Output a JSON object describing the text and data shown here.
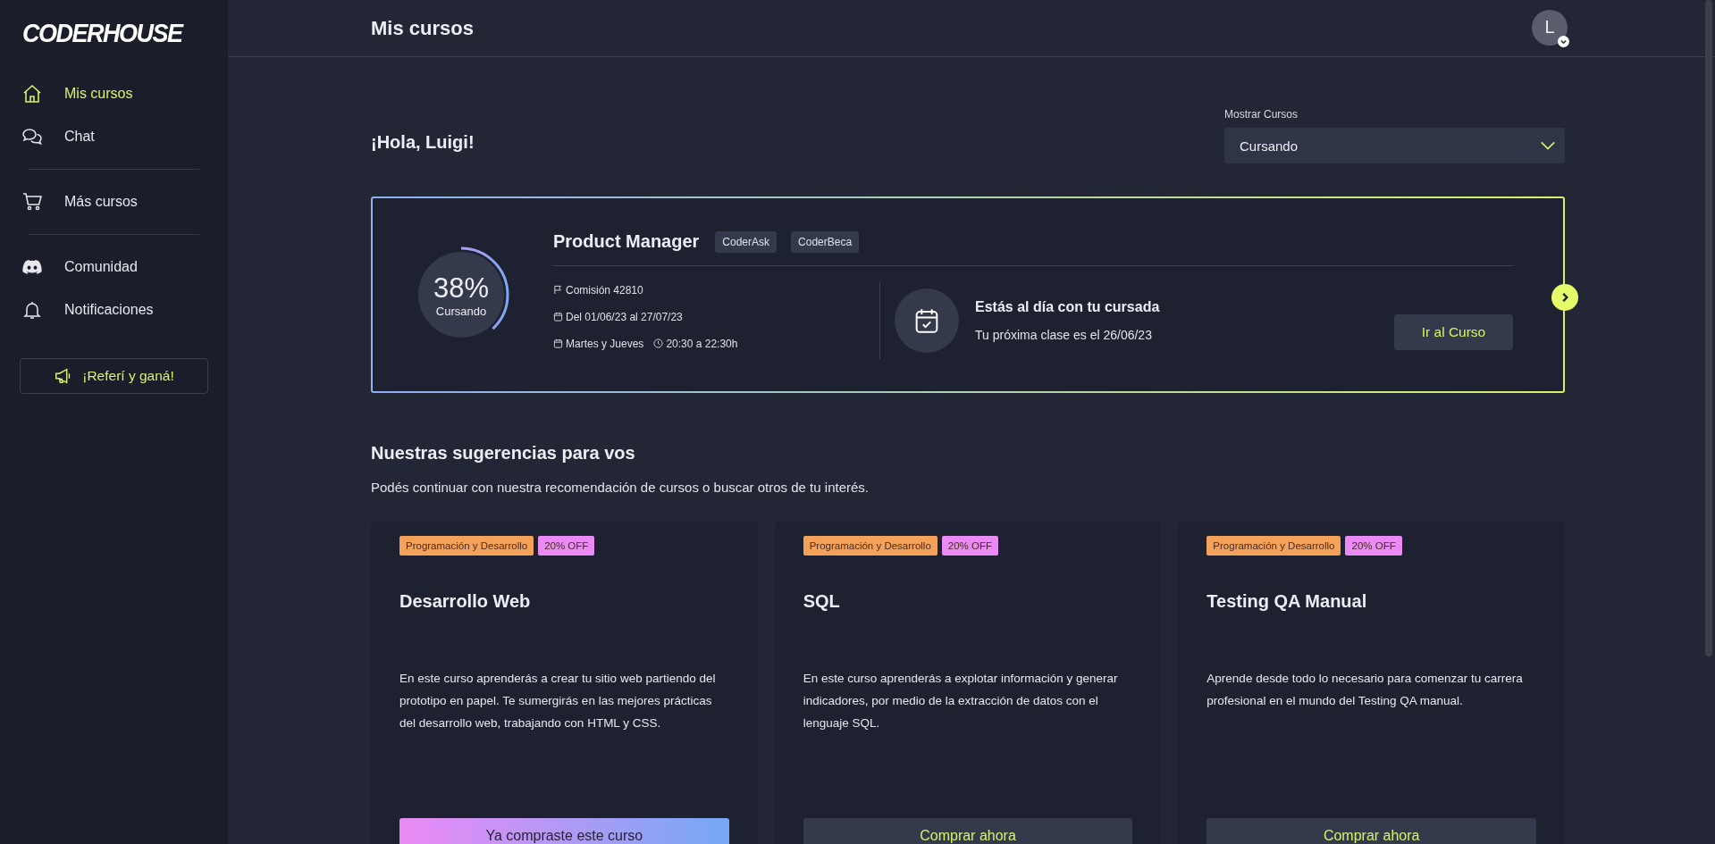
{
  "logo": "CODERHOUSE",
  "sidebar": {
    "sections": [
      [
        {
          "label": "Mis cursos",
          "kind": "home",
          "selected": true
        },
        {
          "label": "Chat",
          "kind": "chat",
          "selected": false
        }
      ],
      [
        {
          "label": "Más cursos",
          "kind": "shop",
          "selected": false
        }
      ],
      [
        {
          "label": "Comunidad",
          "kind": "community",
          "selected": false
        },
        {
          "label": "Notificaciones",
          "kind": "notifications",
          "selected": false
        }
      ]
    ],
    "refer_button": "¡Referí y ganá!"
  },
  "header": {
    "title": "Mis cursos",
    "avatar": "L"
  },
  "greeting": "¡Hola, Luigi!",
  "filter": {
    "label": "Mostrar Cursos",
    "value": "Cursando"
  },
  "course": {
    "title": "Product Manager",
    "tags": [
      "CoderAsk",
      "CoderBeca"
    ],
    "percent": "38%",
    "status": "Cursando",
    "level": 0.38,
    "commission": "Comisión 42810",
    "dates": "Del 01/06/23 al 27/07/23",
    "days": "Martes y Jueves",
    "time": "20:30 a 22:30h",
    "notice_title": "Estás al día con tu cursada",
    "notice_text": "Tu próxima clase es el 26/06/23",
    "button": "Ir al Curso"
  },
  "suggestions": {
    "title": "Nuestras sugerencias para vos",
    "subtitle": "Podés continuar con nuestra recomendación de cursos o buscar otros de tu interés.",
    "cards": [
      {
        "tags": [
          {
            "label": "Programación y Desarrollo",
            "color": "#f4a25a"
          },
          {
            "label": "20% OFF",
            "color": "#e98af5"
          }
        ],
        "title": "Desarrollo Web",
        "description": "En este curso aprenderás a crear tu sitio web partiendo del prototipo en papel. Te sumergirás en las mejores prácticas del desarrollo web, trabajando con HTML y CSS.",
        "kind": "purchased",
        "button": "Ya compraste este curso"
      },
      {
        "tags": [
          {
            "label": "Programación y Desarrollo",
            "color": "#f4a25a"
          },
          {
            "label": "20% OFF",
            "color": "#e98af5"
          }
        ],
        "title": "SQL",
        "description": "En este curso aprenderás a explotar información y generar indicadores, por medio de la extracción de datos con el lenguaje SQL.",
        "kind": "buy",
        "button": "Comprar ahora"
      },
      {
        "tags": [
          {
            "label": "Programación y Desarrollo",
            "color": "#f4a25a"
          },
          {
            "label": "20% OFF",
            "color": "#e98af5"
          }
        ],
        "title": "Testing QA Manual",
        "description": "Aprende desde todo lo necesario para comenzar tu carrera profesional en el mundo del Testing QA manual.",
        "kind": "buy",
        "button": "Comprar ahora"
      }
    ]
  }
}
